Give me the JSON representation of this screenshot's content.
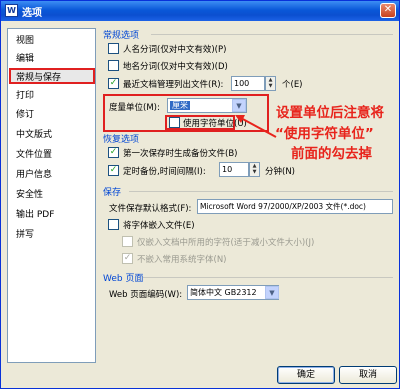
{
  "window": {
    "title": "选项",
    "icon_letter": "W"
  },
  "sidebar": {
    "items": [
      {
        "label": "视图"
      },
      {
        "label": "编辑"
      },
      {
        "label": "常规与保存"
      },
      {
        "label": "打印"
      },
      {
        "label": "修订"
      },
      {
        "label": "中文版式"
      },
      {
        "label": "文件位置"
      },
      {
        "label": "用户信息"
      },
      {
        "label": "安全性"
      },
      {
        "label": "输出 PDF"
      },
      {
        "label": "拼写"
      }
    ],
    "selected_index": 2
  },
  "general": {
    "title": "常规选项",
    "person_name": "人名分词(仅对中文有效)(P)",
    "place_name": "地名分词(仅对中文有效)(D)",
    "recent_files": "最近文档管理列出文件(R):",
    "recent_count": "100",
    "recent_unit": "个(E)",
    "unit_label": "度量单位(M):",
    "unit_value": "厘米",
    "use_char_unit": "使用字符单位(U)"
  },
  "recovery": {
    "title": "恢复选项",
    "first_save_backup": "第一次保存时生成备份文件(B)",
    "timed_backup": "定时备份,时间间隔(I):",
    "interval": "10",
    "interval_unit": "分钟(N)"
  },
  "save": {
    "title": "保存",
    "default_format_label": "文件保存默认格式(F):",
    "default_format_value": "Microsoft Word 97/2000/XP/2003 文件(*.doc)",
    "embed_fonts": "将字体嵌入文件(E)",
    "embed_used_only": "仅嵌入文档中所用的字符(适于减小文件大小)(J)",
    "no_common_fonts": "不嵌入常用系统字体(N)"
  },
  "web": {
    "title": "Web 页面",
    "encoding_label": "Web 页面编码(W):",
    "encoding_value": "简体中文 GB2312"
  },
  "annotation": {
    "line1": "设置单位后注意将",
    "line2": "“使用字符单位”",
    "line3": "前面的勾去掉"
  },
  "buttons": {
    "ok": "确定",
    "cancel": "取消"
  },
  "colors": {
    "annotation": "#e8241c",
    "group_title": "#0046d5",
    "titlebar": "#0a58d8"
  }
}
